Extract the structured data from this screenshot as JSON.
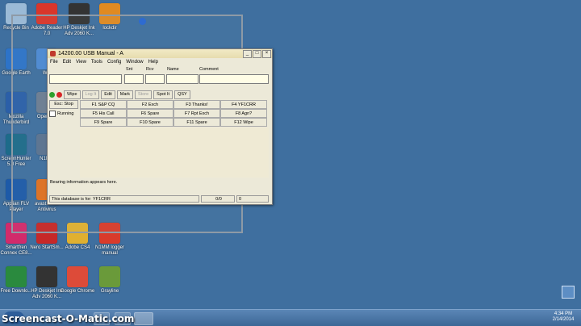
{
  "desktop": {
    "icons": [
      {
        "label": "Recycle Bin",
        "color": "#9bbad6"
      },
      {
        "label": "Adobe Reader 7.0",
        "color": "#d9362b"
      },
      {
        "label": "HP Deskjet Ink Adv 2060 K...",
        "color": "#333333"
      },
      {
        "label": "lockdir",
        "color": "#e08a21"
      },
      {
        "label": "Google Earth",
        "color": "#2d73c8"
      },
      {
        "label": "Win",
        "color": "#4c8ad3"
      },
      {
        "label": "Mozilla Thunderbird",
        "color": "#2b5fa8"
      },
      {
        "label": "OpenO 3",
        "color": "#6c7d92"
      },
      {
        "label": "ScreenHunter 5.0 Free",
        "color": "#1d6b8a"
      },
      {
        "label": "N1MM",
        "color": "#5a7290"
      },
      {
        "label": "Applian FLV Player",
        "color": "#1d5aa8"
      },
      {
        "label": "avast! Free Antivirus",
        "color": "#e07020"
      },
      {
        "label": "Smartfren Connex CE8...",
        "color": "#d12b6b"
      },
      {
        "label": "Nero StartSm...",
        "color": "#c62828"
      },
      {
        "label": "Adobe CS4",
        "color": "#e0b030"
      },
      {
        "label": "N1MM logger manual",
        "color": "#d93b2b"
      },
      {
        "label": "Free Downlo...",
        "color": "#2a8a3e"
      },
      {
        "label": "HP Deskjet Ink Adv 2060 K...",
        "color": "#333333"
      },
      {
        "label": "Google Chrome",
        "color": "#dd4b39"
      },
      {
        "label": "Grayline",
        "color": "#6a9a3a"
      }
    ]
  },
  "window": {
    "title": "14200.00 USB Manual - A",
    "controls": {
      "minimize": "_",
      "maximize": "□",
      "close": "×"
    },
    "menu": [
      "File",
      "Edit",
      "View",
      "Tools",
      "Config",
      "Window",
      "Help"
    ],
    "field_labels": {
      "snt": "Snt",
      "rcv": "Rcv",
      "name": "Name",
      "comment": "Comment"
    },
    "buttons": {
      "wipe": "Wipe",
      "log_it": "Log It",
      "edit": "Edit",
      "mark": "Mark",
      "store": "Store",
      "spot_it": "Spot It",
      "qsy": "QSY",
      "esc_stop": "Esc: Stop",
      "running": "Running"
    },
    "fkeys": [
      "F1 S&P CQ",
      "F2 Exch",
      "F3 Thanks!",
      "F4 YF1CRR",
      "F5 His Call",
      "F6 Spare",
      "F7 Rpt Exch",
      "F8 Agn?",
      "F9 Spare",
      "F10 Spare",
      "F11 Spare",
      "F12 Wipe"
    ],
    "bearing": "Bearing information appears here.",
    "status": {
      "database": "This database is for: YF1CRR",
      "count1": "0/0",
      "count2": "0"
    },
    "colors": {
      "lamp_green": "#2ca02c",
      "lamp_red": "#d62728"
    }
  },
  "taskbar": {
    "clock_time": "4:34 PM",
    "clock_date": "2/14/2014"
  },
  "watermark": "Screencast-O-Matic.com"
}
